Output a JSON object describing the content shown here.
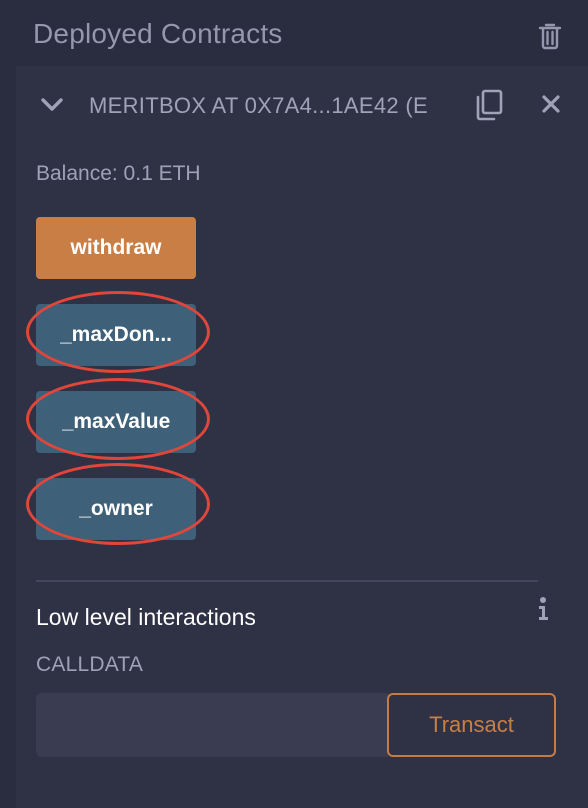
{
  "header": {
    "title": "Deployed Contracts",
    "clear_icon": "trash-icon"
  },
  "contract": {
    "name": "MERITBOX AT 0X7A4...1AE42 (E",
    "expand_icon": "chevron-down-icon",
    "copy_icon": "copy-icon",
    "close_icon": "close-icon",
    "balance": "Balance: 0.1 ETH",
    "functions": [
      {
        "label": "withdraw",
        "kind": "transact"
      },
      {
        "label": "_maxDon...",
        "kind": "call"
      },
      {
        "label": "_maxValue",
        "kind": "call"
      },
      {
        "label": "_owner",
        "kind": "call"
      }
    ]
  },
  "low_level": {
    "title": "Low level interactions",
    "info_icon": "info-icon",
    "calldata_label": "CALLDATA",
    "calldata_value": "",
    "transact_label": "Transact"
  },
  "colors": {
    "background": "#2a2c3f",
    "panel": "#2f3245",
    "transact_button": "#c97e45",
    "call_button": "#3f6079",
    "annotation": "#e0463a"
  }
}
